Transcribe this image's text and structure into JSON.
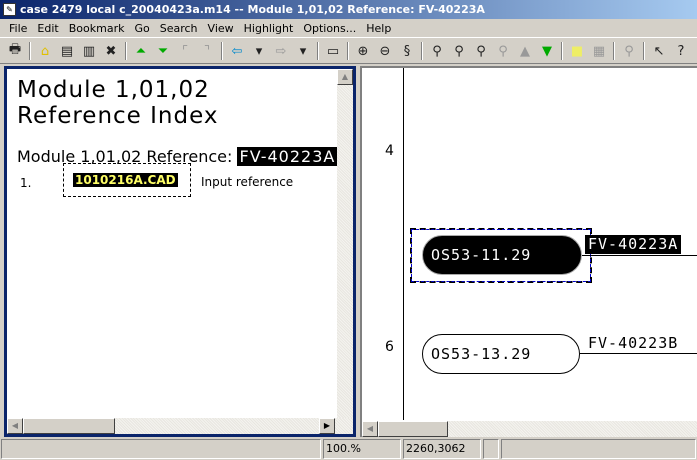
{
  "window": {
    "title": "case 2479 local c_20040423a.m14 -- Module 1,01,02 Reference: FV-40223A"
  },
  "menu": [
    "File",
    "Edit",
    "Bookmark",
    "Go",
    "Search",
    "View",
    "Highlight",
    "Options...",
    "Help"
  ],
  "toolbar": [
    {
      "icon": "print-icon",
      "glyph": "🖶"
    },
    {
      "sep": true
    },
    {
      "icon": "home-icon",
      "glyph": "⌂"
    },
    {
      "icon": "document-icon",
      "glyph": "▤"
    },
    {
      "icon": "document-list-icon",
      "glyph": "▥"
    },
    {
      "icon": "close-document-icon",
      "glyph": "✖"
    },
    {
      "sep": true
    },
    {
      "icon": "first-page-icon",
      "glyph": "⏶"
    },
    {
      "icon": "last-page-icon",
      "glyph": "⏷"
    },
    {
      "icon": "parent-icon",
      "glyph": "⌜"
    },
    {
      "icon": "child-icon",
      "glyph": "⌝"
    },
    {
      "sep": true
    },
    {
      "icon": "back-arrow-icon",
      "glyph": "⇦"
    },
    {
      "icon": "dropdown-icon",
      "glyph": "▾"
    },
    {
      "icon": "forward-arrow-icon",
      "glyph": "⇨"
    },
    {
      "icon": "dropdown-icon",
      "glyph": "▾"
    },
    {
      "sep": true
    },
    {
      "icon": "window-icon",
      "glyph": "▭"
    },
    {
      "sep": true
    },
    {
      "icon": "zoom-in-icon",
      "glyph": "⊕"
    },
    {
      "icon": "zoom-out-icon",
      "glyph": "⊖"
    },
    {
      "icon": "zoom-fit-icon",
      "glyph": "§"
    },
    {
      "sep": true
    },
    {
      "icon": "find-icon",
      "glyph": "⚲"
    },
    {
      "icon": "find-next-icon",
      "glyph": "⚲"
    },
    {
      "icon": "find-all-icon",
      "glyph": "⚲"
    },
    {
      "icon": "find-clear-icon",
      "glyph": "⚲"
    },
    {
      "icon": "previous-hit-icon",
      "glyph": "▲"
    },
    {
      "icon": "next-hit-icon",
      "glyph": "▼"
    },
    {
      "sep": true
    },
    {
      "icon": "highlight-icon",
      "glyph": "■"
    },
    {
      "icon": "annotation-icon",
      "glyph": "▦"
    },
    {
      "sep": true
    },
    {
      "icon": "magnify-icon",
      "glyph": "⚲"
    },
    {
      "sep": true
    },
    {
      "icon": "pointer-icon",
      "glyph": "↖"
    },
    {
      "icon": "help-icon",
      "glyph": "?"
    }
  ],
  "left": {
    "heading_line1": "Module 1,01,02",
    "heading_line2": "Reference Index",
    "reference_label": "Module 1,01,02 Reference:",
    "reference_value": "FV-40223A",
    "items": [
      {
        "number": "1.",
        "file": "1010216A.CAD",
        "description": "Input reference"
      }
    ]
  },
  "drawing": {
    "rows": [
      {
        "row_label": "4",
        "tag": "OS53-11.29",
        "reference": "FV-40223A",
        "selected": true
      },
      {
        "row_label": "6",
        "tag": "OS53-13.29",
        "reference": "FV-40223B",
        "selected": false
      }
    ]
  },
  "status": {
    "message": "",
    "zoom": "100.%",
    "coordinates": "2260,3062",
    "extra": "",
    "info": ""
  },
  "colors": {
    "titlebar": "#0a246a",
    "highlight_bg": "#000000",
    "file_highlight_text": "#ffff66",
    "selection_dash": "#0000cc"
  }
}
